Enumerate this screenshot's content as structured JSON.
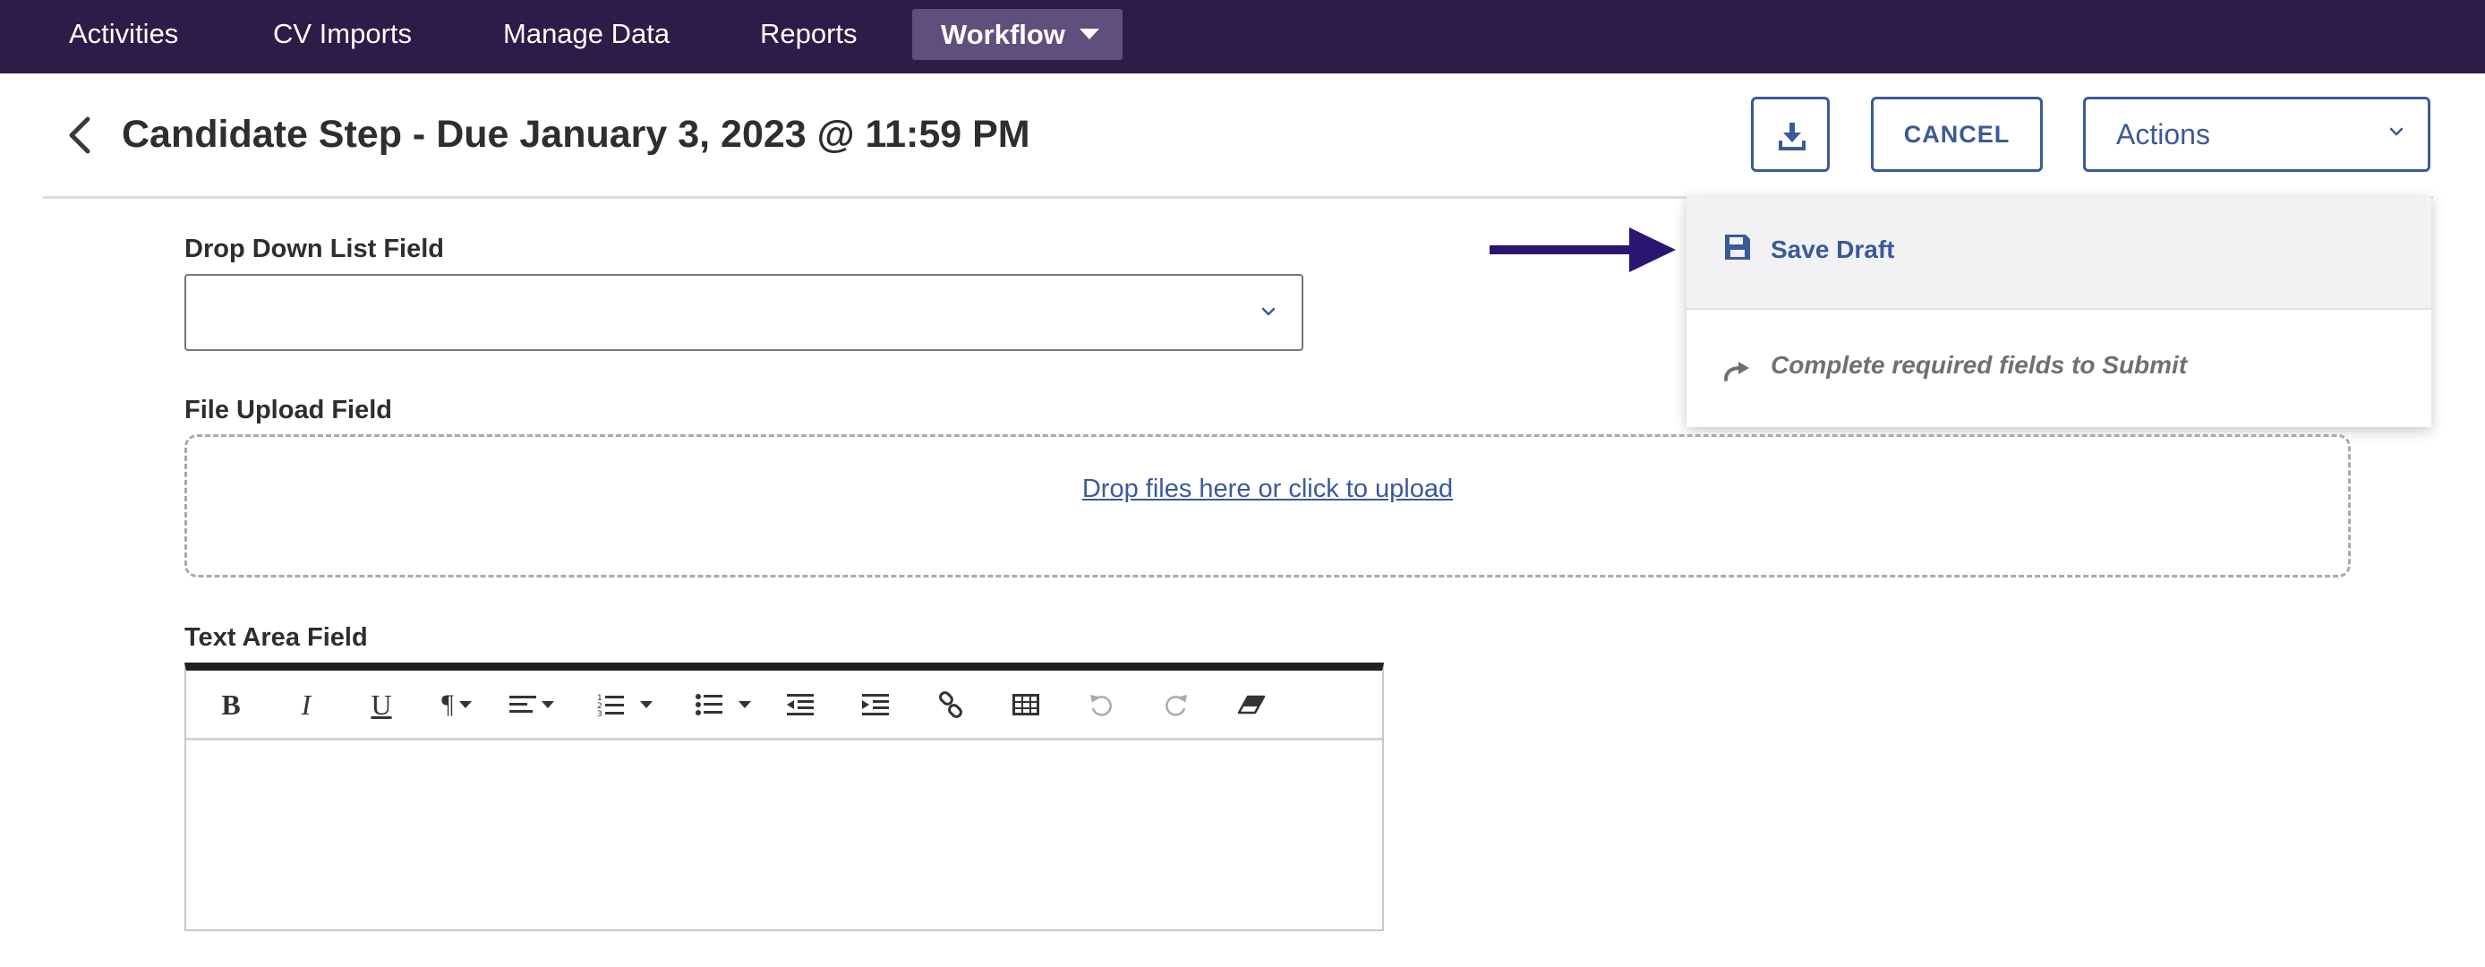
{
  "nav": {
    "items": [
      {
        "label": "Activities"
      },
      {
        "label": "CV Imports"
      },
      {
        "label": "Manage Data"
      },
      {
        "label": "Reports"
      },
      {
        "label": "Workflow"
      }
    ],
    "active_index": 4
  },
  "header": {
    "title": "Candidate Step - Due January 3, 2023 @ 11:59 PM",
    "cancel_label": "CANCEL",
    "actions_label": "Actions"
  },
  "actions_menu": {
    "items": [
      {
        "label": "Save Draft",
        "icon": "save-icon",
        "enabled": true
      },
      {
        "label": "Complete required fields to Submit",
        "icon": "redo-arrow-icon",
        "enabled": false
      }
    ]
  },
  "form": {
    "dropdown_field": {
      "label": "Drop Down List Field",
      "value": ""
    },
    "file_upload_field": {
      "label": "File Upload Field",
      "prompt": "Drop files here or click to upload"
    },
    "text_area_field": {
      "label": "Text Area Field",
      "toolbar": [
        "bold",
        "italic",
        "underline",
        "paragraph",
        "align",
        "ordered-list",
        "unordered-list",
        "outdent",
        "indent",
        "link",
        "table",
        "undo",
        "redo",
        "clear-format"
      ]
    }
  },
  "colors": {
    "nav_bg": "#2c1c47",
    "nav_active_bg": "#5f4f7d",
    "accent": "#3a5a99",
    "annotation_arrow": "#2a1570"
  }
}
